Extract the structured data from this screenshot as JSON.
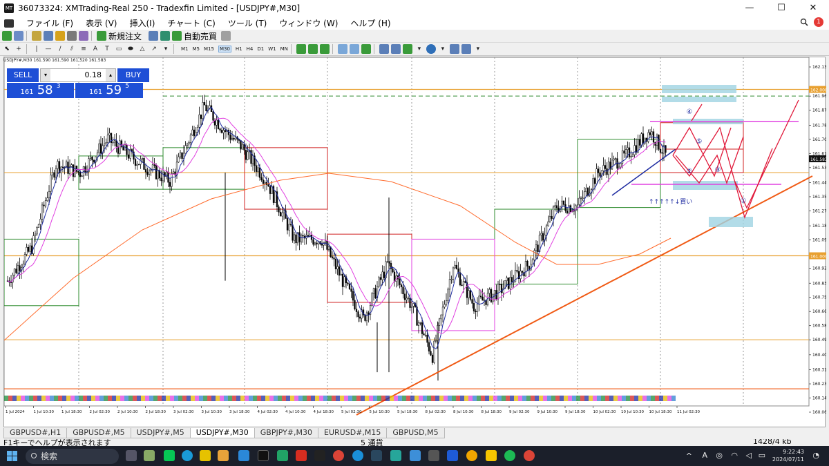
{
  "window": {
    "title": "36073324: XMTrading-Real 250 - Tradexfin Limited - [USDJPY#,M30]",
    "app_icon": "MT",
    "min_label": "—",
    "max_label": "☐",
    "close_label": "✕"
  },
  "menu": {
    "items": [
      "ファイル (F)",
      "表示 (V)",
      "挿入(I)",
      "チャート (C)",
      "ツール (T)",
      "ウィンドウ (W)",
      "ヘルプ (H)"
    ],
    "notifications": "1"
  },
  "toolbar": {
    "new_order": "新規注文",
    "auto_trade": "自動売買",
    "timeframes": [
      "M1",
      "M5",
      "M15",
      "M30",
      "H1",
      "H4",
      "D1",
      "W1",
      "MN"
    ],
    "selected_timeframe": "M30"
  },
  "chart": {
    "symbol_line": "USDJPY#,M30  161.590 161.590 161.520 161.583",
    "current_price": "161.583",
    "price_labels": [
      "162.135",
      "162.000",
      "161.960",
      "161.875",
      "161.785",
      "161.700",
      "161.615",
      "161.530",
      "161.440",
      "161.355",
      "161.270",
      "161.180",
      "161.095",
      "161.010",
      "161.000",
      "160.925",
      "160.835",
      "160.750",
      "160.665",
      "160.580",
      "160.495",
      "160.405",
      "160.315",
      "160.230",
      "160.145",
      "160.060"
    ],
    "time_labels": [
      "1 Jul 2024",
      "1 Jul 10:30",
      "1 Jul 18:30",
      "2 Jul 02:30",
      "2 Jul 10:30",
      "2 Jul 18:30",
      "3 Jul 02:30",
      "3 Jul 10:30",
      "3 Jul 18:30",
      "4 Jul 02:30",
      "4 Jul 10:30",
      "4 Jul 18:30",
      "5 Jul 02:30",
      "5 Jul 10:30",
      "5 Jul 18:30",
      "8 Jul 02:30",
      "8 Jul 10:30",
      "8 Jul 18:30",
      "9 Jul 02:30",
      "9 Jul 10:30",
      "9 Jul 18:30",
      "10 Jul 02:30",
      "10 Jul 10:30",
      "10 Jul 18:30",
      "11 Jul 02:30"
    ],
    "annotations": {
      "buy_text": "↑↑↑↑↑↓買い",
      "circle_labels": [
        "①",
        "②",
        "③",
        "④",
        "⑤"
      ]
    },
    "colors": {
      "candle": "#000000",
      "ma_fast": "#1c2aa0",
      "ma_mid": "#e040e0",
      "ma_slow": "#ff6a2b",
      "trend": "#f05a14",
      "box_green": "#2e8b2e",
      "box_red": "#d02020",
      "box_blue": "#2040e0",
      "box_magenta": "#e040e0",
      "zone": "#9fd3e2",
      "level_orange": "#e8a030",
      "level_red": "#f05a14"
    }
  },
  "trade_panel": {
    "sell_label": "SELL",
    "buy_label": "BUY",
    "lot": "0.18",
    "bid": {
      "small": "161",
      "big": "58",
      "sup": "3"
    },
    "ask": {
      "small": "161",
      "big": "59",
      "sup": "5"
    }
  },
  "tabs": [
    "GBPUSD#,H1",
    "GBPUSD#,M5",
    "USDJPY#,M5",
    "USDJPY#,M30",
    "GBPJPY#,M30",
    "EURUSD#,M15",
    "GBPUSD,M5"
  ],
  "active_tab": 3,
  "status": {
    "help": "F1キーでヘルプが表示されます",
    "conn": "5 通貨",
    "traffic": "1428/4 kb"
  },
  "taskbar": {
    "search": "検索",
    "time": "9:22:43",
    "date": "2024/07/11",
    "lang": "A"
  }
}
